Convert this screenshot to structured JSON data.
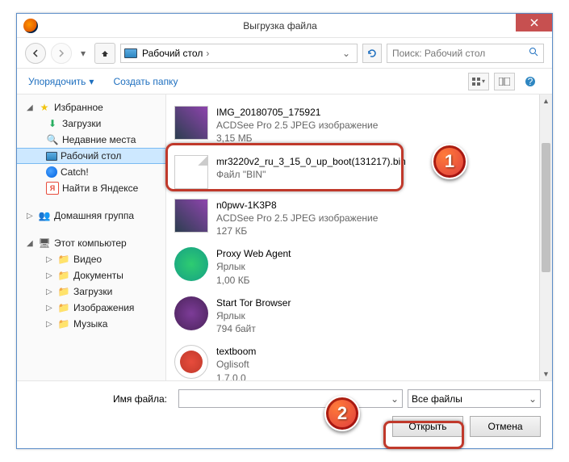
{
  "titlebar": {
    "title": "Выгрузка файла"
  },
  "nav": {
    "breadcrumb_location": "Рабочий стол",
    "search_placeholder": "Поиск: Рабочий стол"
  },
  "toolbar": {
    "organize": "Упорядочить",
    "new_folder": "Создать папку"
  },
  "sidebar": {
    "favorites": "Избранное",
    "downloads": "Загрузки",
    "recent": "Недавние места",
    "desktop": "Рабочий стол",
    "catch": "Catch!",
    "yandex": "Найти в Яндексе",
    "homegroup": "Домашняя группа",
    "this_pc": "Этот компьютер",
    "video": "Видео",
    "documents": "Документы",
    "downloads2": "Загрузки",
    "pictures": "Изображения",
    "music": "Музыка"
  },
  "files": [
    {
      "name": "IMG_20180705_175921",
      "type": "ACDSee Pro 2.5 JPEG изображение",
      "size": "3,15 МБ",
      "thumb": "dark"
    },
    {
      "name": "mr3220v2_ru_3_15_0_up_boot(131217).bin",
      "type": "Файл \"BIN\"",
      "size": "",
      "thumb": "blank"
    },
    {
      "name": "n0pwv-1K3P8",
      "type": "ACDSee Pro 2.5 JPEG изображение",
      "size": "127 КБ",
      "thumb": "dark"
    },
    {
      "name": "Proxy Web Agent",
      "type": "Ярлык",
      "size": "1,00 КБ",
      "thumb": "globe"
    },
    {
      "name": "Start Tor Browser",
      "type": "Ярлык",
      "size": "794 байт",
      "thumb": "onion"
    },
    {
      "name": "textboom",
      "type": "Oglisoft",
      "size": "1.7.0.0",
      "thumb": "red"
    }
  ],
  "bottom": {
    "filename_label": "Имя файла:",
    "filename_value": "",
    "filter": "Все файлы",
    "open": "Открыть",
    "cancel": "Отмена"
  },
  "badges": {
    "b1": "1",
    "b2": "2"
  }
}
